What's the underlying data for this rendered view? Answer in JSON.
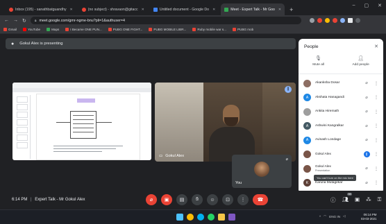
{
  "browser": {
    "tabs": [
      {
        "title": "Inbox (195) - sanathbatguandhy",
        "favicon_color": "#ea4335",
        "active": false
      },
      {
        "title": "(no subject) - shravaon@gitacc",
        "favicon_color": "#ea4335",
        "active": false
      },
      {
        "title": "Untitled document - Google Do",
        "favicon_color": "#4285f4",
        "active": false
      },
      {
        "title": "Meet - Expert Talk - Mr Goo",
        "favicon_color": "#34a853",
        "active": true
      }
    ],
    "new_tab": "+",
    "url": "meet.google.com/gmr-ngme-bnu?pli=1&authuser=4",
    "bookmarks": [
      {
        "label": "Gmail",
        "color": "#ea4335"
      },
      {
        "label": "YouTube",
        "color": "#ff0000"
      },
      {
        "label": "Maps",
        "color": "#34a853"
      },
      {
        "label": "I Became ONE PUN...",
        "color": "#ea4335"
      },
      {
        "label": "PUBG ONE FIGHT...",
        "color": "#ea4335"
      },
      {
        "label": "PUBG MOBILE LIBR...",
        "color": "#ea4335"
      },
      {
        "label": "Ruby mobile war s...",
        "color": "#ea4335"
      },
      {
        "label": "PUBG mob",
        "color": "#ea4335"
      }
    ]
  },
  "meet": {
    "presenting_text": "Gokul Alex is presenting",
    "camera_tile_name": "Gokul Alex",
    "self_tile_name": "You",
    "meeting_time": "6:14 PM",
    "meeting_title": "Expert Talk - Mr Gokul Alex",
    "separator": "|"
  },
  "people_panel": {
    "title": "People",
    "mute_all": "Mute all",
    "add_people": "Add people",
    "participants": [
      {
        "name": "Akanksha Dosar",
        "initial": "",
        "color": "#8d6e63",
        "mic": "muted"
      },
      {
        "name": "Akshata Hanagandi",
        "initial": "A",
        "color": "#1e88e5",
        "mic": "muted"
      },
      {
        "name": "Ankita Hiremath",
        "initial": "",
        "color": "#9e9e9e",
        "mic": "muted"
      },
      {
        "name": "Ashwini Kangralkar",
        "initial": "A",
        "color": "#455a64",
        "mic": "muted"
      },
      {
        "name": "Avinash Londage",
        "initial": "A",
        "color": "#1e88e5",
        "mic": "muted"
      },
      {
        "name": "Gokul Alex",
        "initial": "",
        "color": "#795548",
        "mic": "on"
      },
      {
        "name": "Gokul Alex",
        "sub": "Presentation",
        "initial": "",
        "color": "#795548",
        "mic": "muted"
      },
      {
        "name": "Karuna Mutagekar",
        "initial": "K",
        "color": "#5d4037",
        "mic": "muted"
      }
    ],
    "tooltip": "You can't turn on the mic here"
  },
  "controls": {
    "participants_count": "39"
  },
  "taskbar": {
    "lang": "ENG",
    "region": "IN",
    "time": "06:14 PM",
    "date": "03-03-2021"
  }
}
